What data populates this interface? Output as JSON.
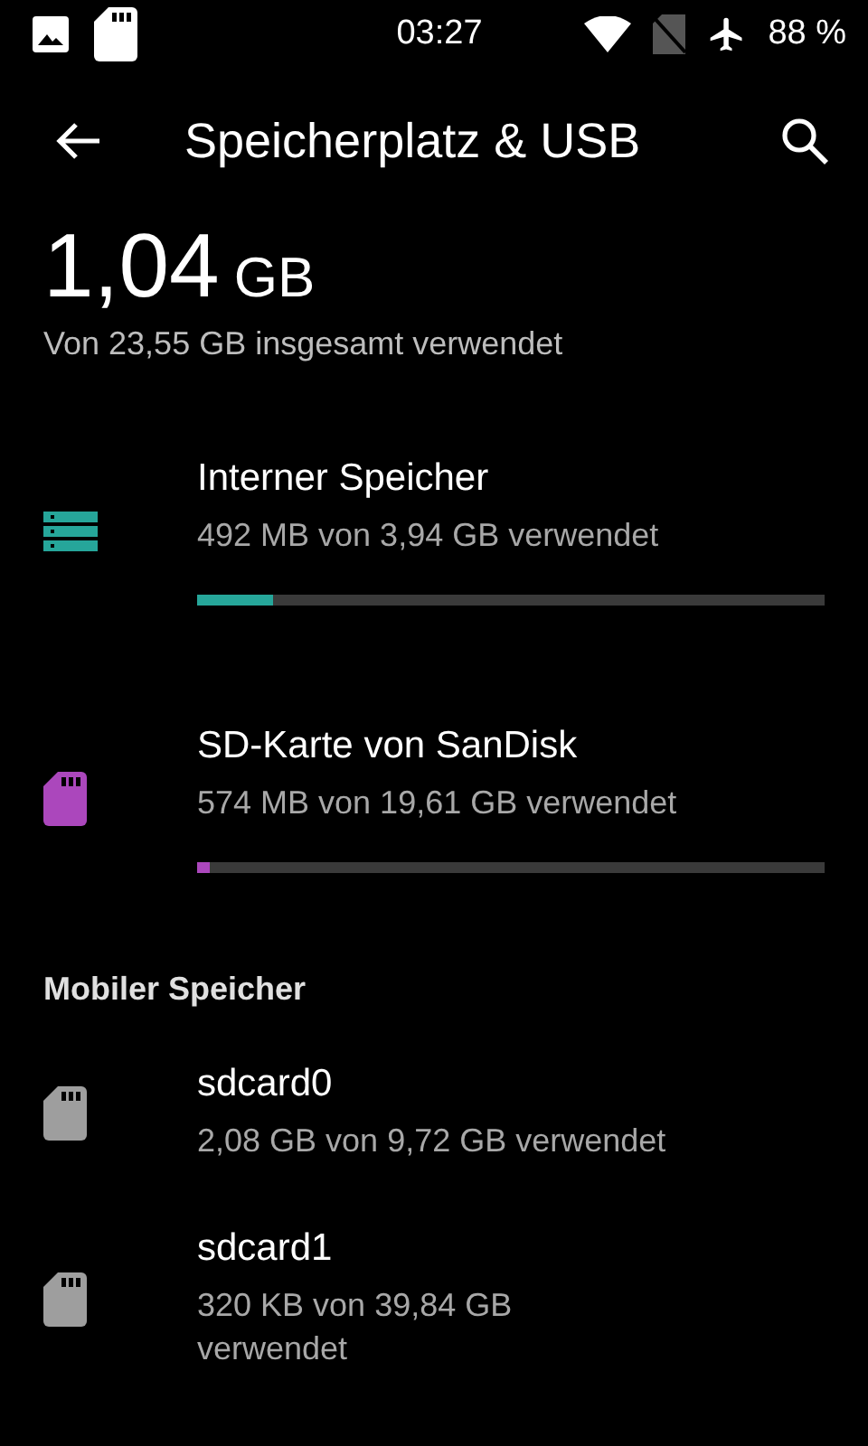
{
  "status_bar": {
    "time": "03:27",
    "battery": "88 %"
  },
  "toolbar": {
    "title": "Speicherplatz & USB"
  },
  "summary": {
    "amount": "1,04",
    "unit": "GB",
    "caption": "Von 23,55 GB insgesamt verwendet"
  },
  "devices": [
    {
      "kind": "internal",
      "name": "Interner Speicher",
      "usage": "492 MB von 3,94 GB verwendet",
      "level": 0.12,
      "color": "#26a69a"
    },
    {
      "kind": "sd",
      "name": "SD-Karte von SanDisk",
      "usage": "574 MB von 19,61 GB verwendet",
      "level": 0.02,
      "color": "#ab47bc"
    }
  ],
  "portable": {
    "header": "Mobiler Speicher",
    "items": [
      {
        "name": "sdcard0",
        "usage": "2,08 GB von 9,72 GB verwendet"
      },
      {
        "name": "sdcard1",
        "usage": "320 KB von 39,84 GB\nverwendet"
      }
    ]
  }
}
